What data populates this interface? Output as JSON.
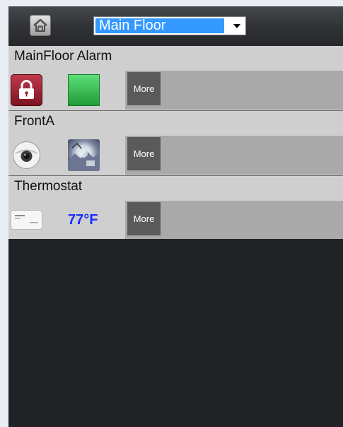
{
  "header": {
    "home_icon": "home-icon",
    "floor_select": {
      "selected": "Main Floor"
    }
  },
  "devices": [
    {
      "name": "MainFloor Alarm",
      "icon_1": "lock-icon",
      "icon_2": "green-status-tile",
      "more_label": "More"
    },
    {
      "name": "FrontA",
      "icon_1": "security-camera-icon",
      "icon_2": "camera-snapshot-thumbnail",
      "more_label": "More"
    },
    {
      "name": "Thermostat",
      "icon_1": "thermostat-icon",
      "temperature": "77°F",
      "more_label": "More"
    }
  ],
  "colors": {
    "background": "#202225",
    "row_background": "#cfcfcf",
    "more_button": "#5a5a5a",
    "select_highlight": "#3399ff",
    "temperature_text": "#1b2cff",
    "alarm_lock": "#a3263a",
    "status_green": "#3cc15a"
  }
}
